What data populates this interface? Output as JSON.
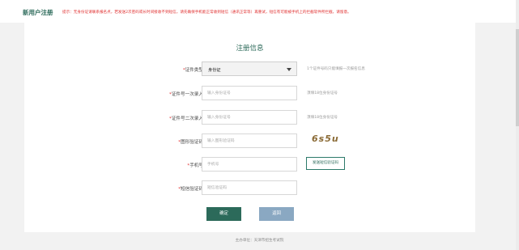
{
  "header": {
    "title": "新用户注册",
    "notice": "提示：无身份证请联系报名点，若发送2次密码或长时间接收不到短信，请先确保手机能正常收到短信（通讯正常等）再重试，短信有可能被手机上的拦截软件所拦截，请留意。"
  },
  "form": {
    "title": "注册信息",
    "id_type": {
      "label": "证件类型",
      "value": "身份证",
      "hint": "1个证件号码只能填报一次报名信息"
    },
    "id_first": {
      "label": "证件号一次录入",
      "placeholder": "输入身份证号",
      "hint": "须填18位身份证号"
    },
    "id_second": {
      "label": "证件号二次录入",
      "placeholder": "输入身份证号",
      "hint": "须填18位身份证号"
    },
    "captcha": {
      "label": "图形验证码",
      "placeholder": "输入图形验证码",
      "image_text": "6s5u"
    },
    "phone": {
      "label": "手机号",
      "placeholder": "手机号",
      "send_button": "发送短信验证码"
    },
    "sms_code": {
      "label": "短信验证码",
      "placeholder": "短信验证码"
    },
    "confirm_button": "确定",
    "back_button": "返回"
  },
  "footer": {
    "text": "主办单位：天津市招生考试院"
  },
  "colors": {
    "brand": "#2c6a5a",
    "notice": "#e03030",
    "back_button": "#8aa8c2"
  }
}
